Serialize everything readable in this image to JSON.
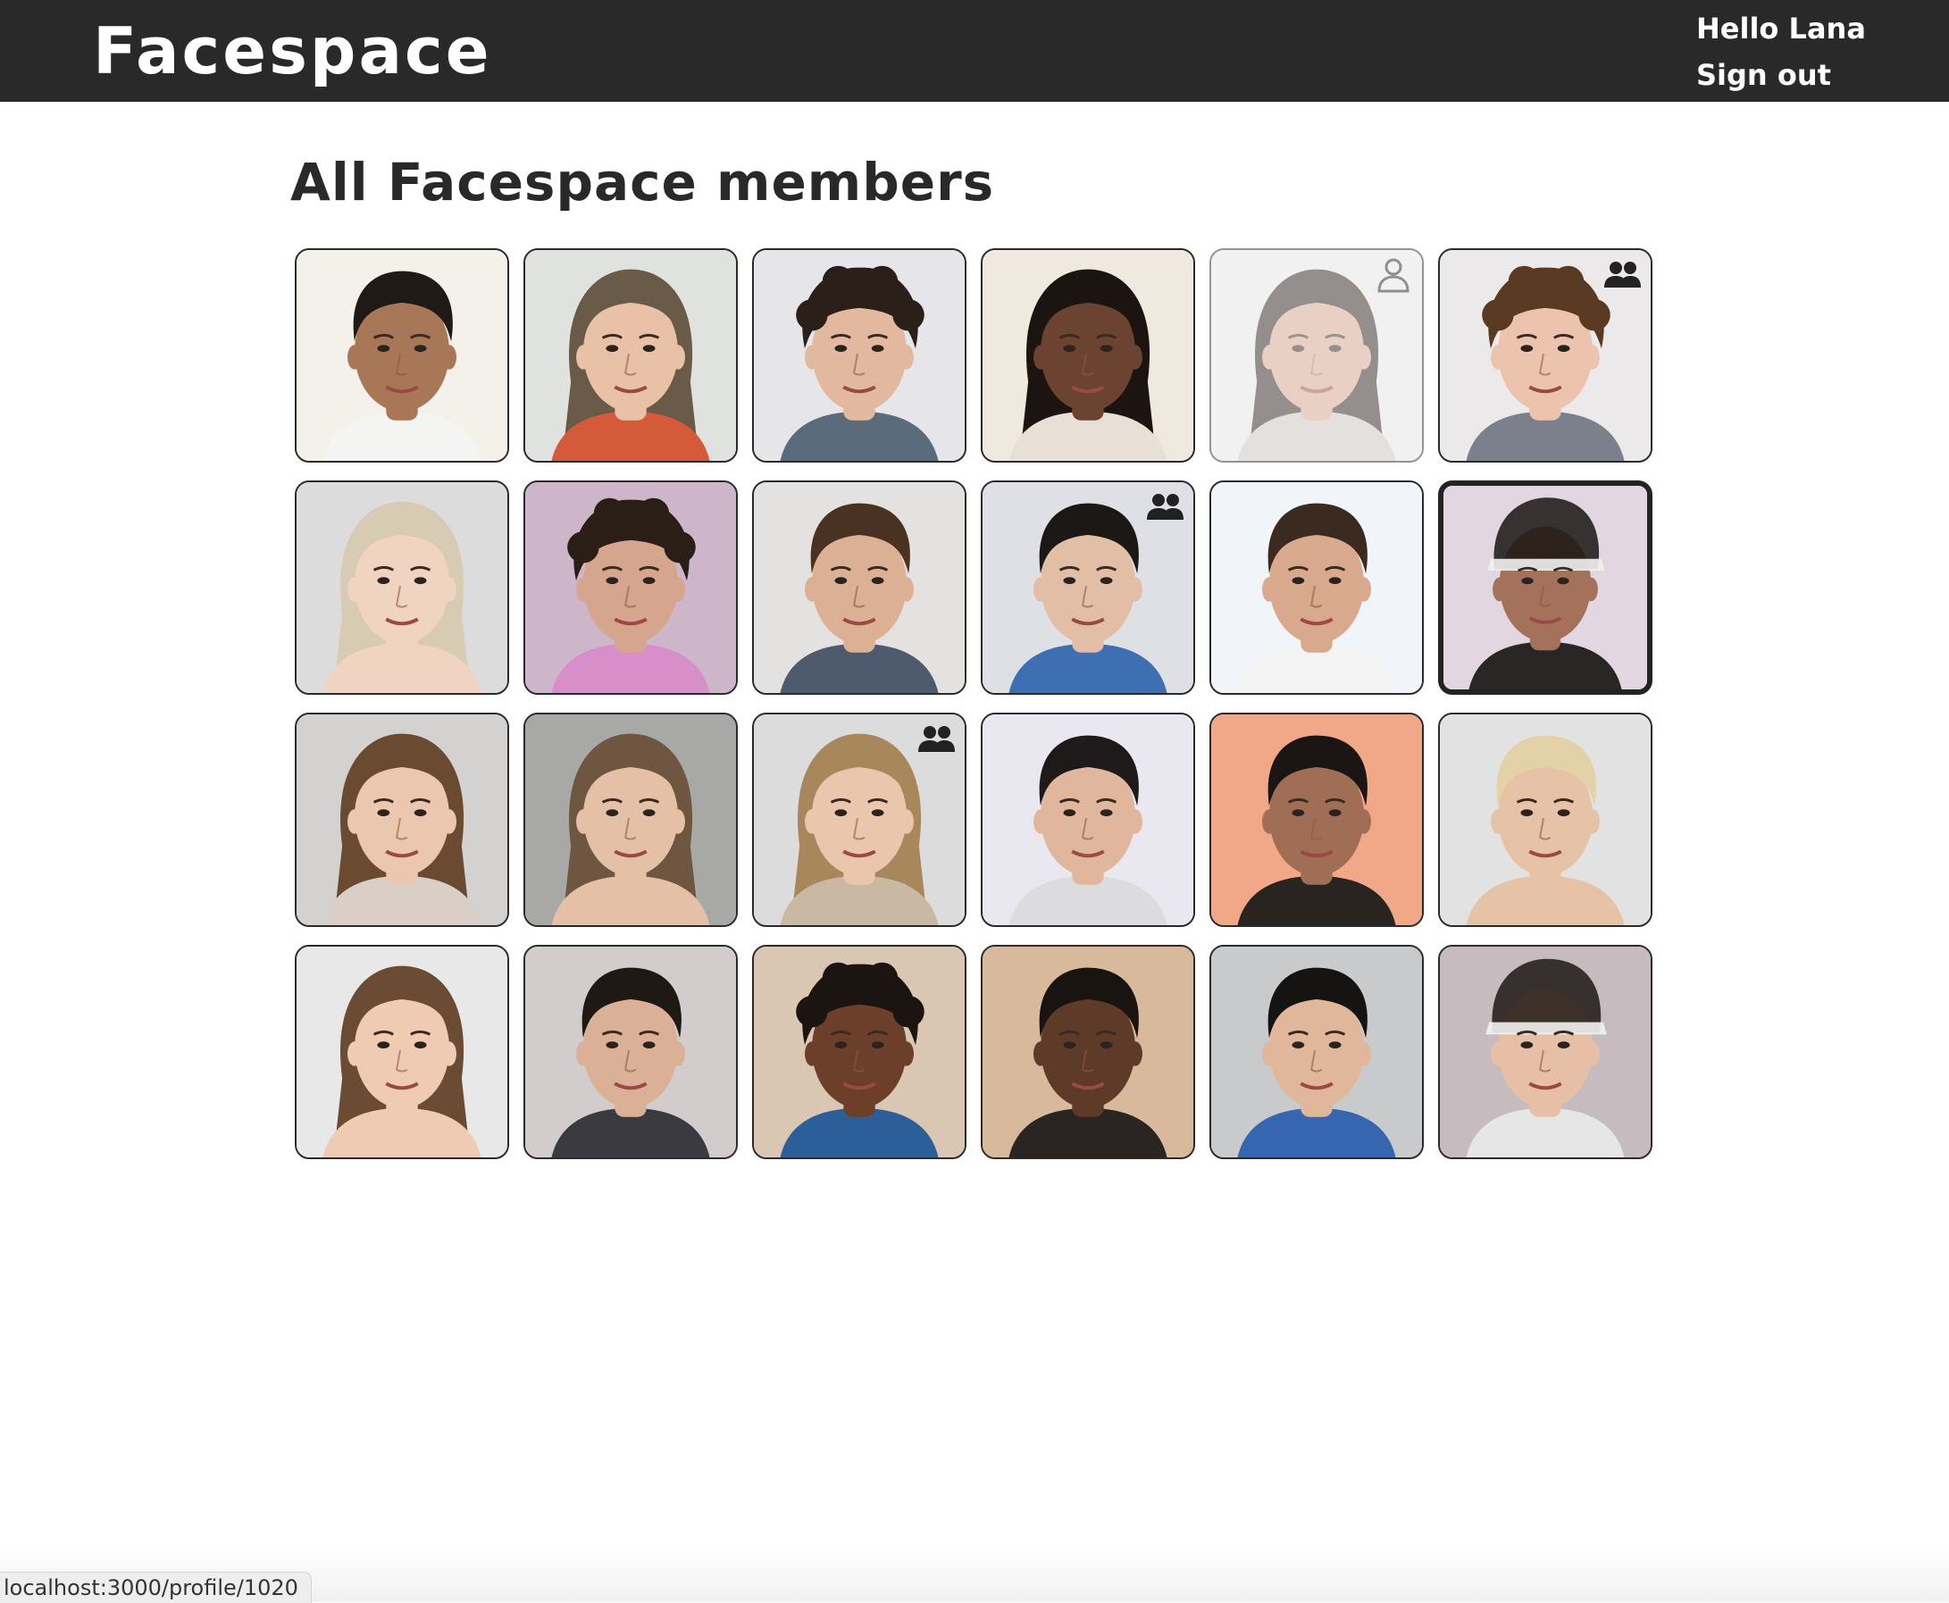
{
  "header": {
    "logo": "Facespace",
    "greeting": "Hello Lana",
    "sign_out": "Sign out"
  },
  "page": {
    "title": "All Facespace members"
  },
  "members": [
    {
      "bg": "#f3f1ea",
      "skin": "#a87758",
      "hair": "#1f1a16",
      "shirt": "#f4f4f2",
      "hair_style": "short",
      "badge": "none",
      "dim": false,
      "selected": false
    },
    {
      "bg": "#dfe2df",
      "skin": "#e8c1a6",
      "hair": "#6a5a48",
      "shirt": "#d45a3a",
      "hair_style": "long",
      "badge": "none",
      "dim": false,
      "selected": false
    },
    {
      "bg": "#e6e6ea",
      "skin": "#e2b99e",
      "hair": "#2a1f19",
      "shirt": "#5a6b7c",
      "hair_style": "curly",
      "badge": "none",
      "dim": false,
      "selected": false
    },
    {
      "bg": "#efe9df",
      "skin": "#6b4330",
      "hair": "#1b1411",
      "shirt": "#e8e0d6",
      "hair_style": "long",
      "badge": "none",
      "dim": false,
      "selected": false
    },
    {
      "bg": "#e6e4e4",
      "skin": "#d3a58a",
      "hair": "#2b211d",
      "shirt": "#c9c2bd",
      "hair_style": "long",
      "badge": "user-icon",
      "dim": true,
      "selected": false
    },
    {
      "bg": "#ece9ea",
      "skin": "#ecc4ad",
      "hair": "#5a3a22",
      "shirt": "#7c7f8c",
      "hair_style": "curly",
      "badge": "friends-icon",
      "dim": false,
      "selected": false
    },
    {
      "bg": "#dcdcdc",
      "skin": "#f1d3c2",
      "hair": "#d8cbb3",
      "shirt": "#f1d3c2",
      "hair_style": "long",
      "badge": "none",
      "dim": false,
      "selected": false
    },
    {
      "bg": "#cdb6c9",
      "skin": "#d6a58e",
      "hair": "#2b1e17",
      "shirt": "#d88fc9",
      "hair_style": "curly",
      "badge": "none",
      "dim": false,
      "selected": false
    },
    {
      "bg": "#e3e2e0",
      "skin": "#dcb094",
      "hair": "#4a3222",
      "shirt": "#4e5a6e",
      "hair_style": "short",
      "badge": "none",
      "dim": false,
      "selected": false
    },
    {
      "bg": "#dfe0e6",
      "skin": "#e2bea7",
      "hair": "#1c1816",
      "shirt": "#3f6fb3",
      "hair_style": "short",
      "badge": "friends-icon",
      "dim": false,
      "selected": false
    },
    {
      "bg": "#f1f4f8",
      "skin": "#d8a98d",
      "hair": "#3b2a20",
      "shirt": "#f4f4f4",
      "hair_style": "short",
      "badge": "none",
      "dim": false,
      "selected": false
    },
    {
      "bg": "#e2d6e0",
      "skin": "#a4715a",
      "hair": "#1a1412",
      "shirt": "#2a2626",
      "hair_style": "cap",
      "badge": "none",
      "dim": false,
      "selected": true
    },
    {
      "bg": "#d4d2d0",
      "skin": "#ecc7b0",
      "hair": "#6a4a30",
      "shirt": "#d9cfc6",
      "hair_style": "long",
      "badge": "none",
      "dim": false,
      "selected": false
    },
    {
      "bg": "#a8a8a6",
      "skin": "#e4c0a6",
      "hair": "#6e5640",
      "shirt": "#e4c0a6",
      "hair_style": "long",
      "badge": "none",
      "dim": false,
      "selected": false
    },
    {
      "bg": "#dcdcdc",
      "skin": "#eac6ac",
      "hair": "#a8875c",
      "shirt": "#c9b8a4",
      "hair_style": "long",
      "badge": "friends-icon",
      "dim": false,
      "selected": false
    },
    {
      "bg": "#e9e7ef",
      "skin": "#e0b79c",
      "hair": "#1d1a19",
      "shirt": "#dcdcdf",
      "hair_style": "short",
      "badge": "none",
      "dim": false,
      "selected": false
    },
    {
      "bg": "#f0a889",
      "skin": "#a06e54",
      "hair": "#1b1613",
      "shirt": "#2a2421",
      "hair_style": "short",
      "badge": "none",
      "dim": false,
      "selected": false
    },
    {
      "bg": "#e2e2e2",
      "skin": "#e6c2a6",
      "hair": "#e3d2a8",
      "shirt": "#e6c2a6",
      "hair_style": "short",
      "badge": "none",
      "dim": false,
      "selected": false
    },
    {
      "bg": "#e8e8e8",
      "skin": "#efcbb4",
      "hair": "#6b4b33",
      "shirt": "#efcbb4",
      "hair_style": "long",
      "badge": "none",
      "dim": false,
      "selected": false
    },
    {
      "bg": "#d2cccc",
      "skin": "#dab196",
      "hair": "#1f1916",
      "shirt": "#3a3a40",
      "hair_style": "short",
      "badge": "none",
      "dim": false,
      "selected": false
    },
    {
      "bg": "#d9c7b3",
      "skin": "#6b3f2a",
      "hair": "#1c1410",
      "shirt": "#2c5e9a",
      "hair_style": "curly",
      "badge": "none",
      "dim": false,
      "selected": false
    },
    {
      "bg": "#d8b99c",
      "skin": "#5e3a28",
      "hair": "#1a1410",
      "shirt": "#2a2422",
      "hair_style": "short",
      "badge": "none",
      "dim": false,
      "selected": false
    },
    {
      "bg": "#c9cacc",
      "skin": "#e0b79a",
      "hair": "#161413",
      "shirt": "#3766b1",
      "hair_style": "short",
      "badge": "none",
      "dim": false,
      "selected": false
    },
    {
      "bg": "#c6bcbf",
      "skin": "#e7bfa6",
      "hair": "#1f1714",
      "shirt": "#e6e6e6",
      "hair_style": "cap",
      "badge": "none",
      "dim": false,
      "selected": false
    }
  ],
  "status_bar": {
    "url": "localhost:3000/profile/1020"
  }
}
